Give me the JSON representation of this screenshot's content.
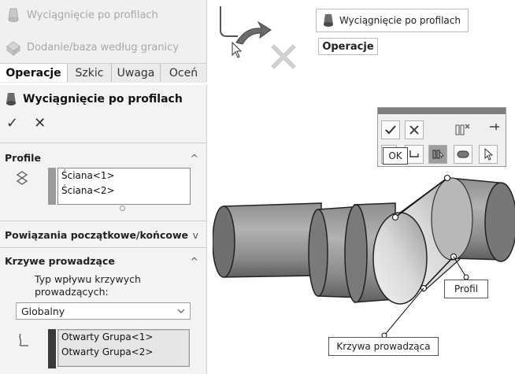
{
  "ribbon": {
    "items": [
      {
        "label": "Wyciągnięcie po profilach",
        "icon": "loft-icon"
      },
      {
        "label": "Dodanie/baza według granicy",
        "icon": "boundary-boss-icon"
      }
    ],
    "tabs": [
      {
        "label": "Operacje",
        "active": true
      },
      {
        "label": "Szkic",
        "active": false
      },
      {
        "label": "Uwaga",
        "active": false
      },
      {
        "label": "Oceń",
        "active": false
      }
    ]
  },
  "property_manager": {
    "title": "Wyciągnięcie po profilach",
    "ok_symbol": "✓",
    "cancel_symbol": "✕",
    "profile_section": {
      "label": "Profile",
      "collapse_symbol": "^",
      "items": [
        "Ściana<1>",
        "Ściana<2>"
      ]
    },
    "constraints_section": {
      "label": "Powiązania początkowe/końcowe",
      "expand_symbol": "v"
    },
    "guide_section": {
      "label": "Krzywe prowadzące",
      "collapse_symbol": "^",
      "influence_label": "Typ wpływu krzywych prowadzących:",
      "influence_value": "Globalny",
      "items": [
        "Otwarty Grupa<1>",
        "Otwarty Grupa<2>"
      ]
    }
  },
  "tooltip": {
    "label": "Wyciągnięcie po profilach"
  },
  "operacje_tab": {
    "label": "Operacje"
  },
  "popup_toolbar": {
    "ok_tooltip": "OK"
  },
  "callouts": {
    "profile": "Profil",
    "guide": "Krzywa prowadząca"
  },
  "colors": {
    "accent_loft": "#6b6b6b",
    "panel_bg": "#f3f3f3",
    "model_gray": "#8c8c8c"
  }
}
